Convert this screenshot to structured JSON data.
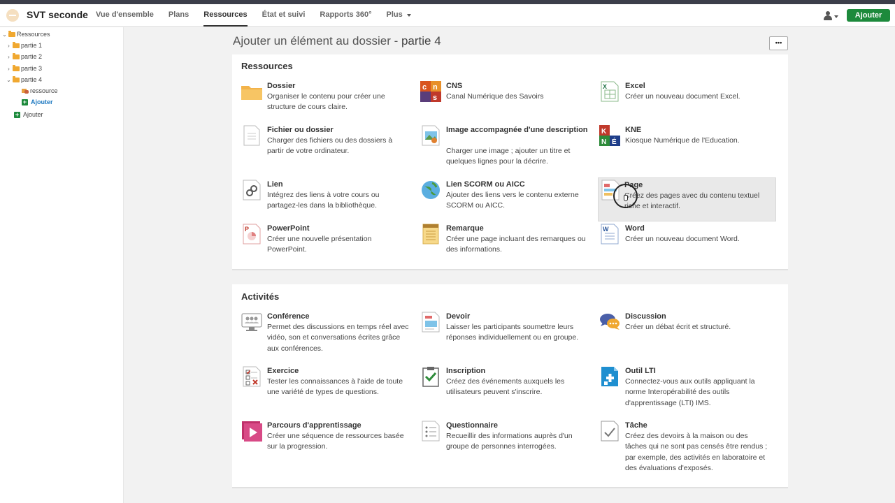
{
  "header": {
    "course_title": "SVT seconde",
    "nav": [
      "Vue d'ensemble",
      "Plans",
      "Ressources",
      "État et suivi",
      "Rapports 360°",
      "Plus"
    ],
    "add_label": "Ajouter"
  },
  "sidebar": {
    "root": "Ressources",
    "parts": [
      "partie 1",
      "partie 2",
      "partie 3",
      "partie 4"
    ],
    "resource": "ressource",
    "add_inner": "Ajouter",
    "add_outer": "Ajouter"
  },
  "page": {
    "title_prefix": "Ajouter un élément au dossier - ",
    "title_folder": "partie 4",
    "menu_label": "•••"
  },
  "resources": {
    "heading": "Ressources",
    "items": [
      {
        "name": "Dossier",
        "desc": "Organiser le contenu pour créer une structure de cours claire.",
        "icon": "folder-icon"
      },
      {
        "name": "CNS",
        "desc": "Canal Numérique des Savoirs",
        "icon": "cns-icon"
      },
      {
        "name": "Excel",
        "desc": "Créer un nouveau document Excel.",
        "icon": "excel-icon"
      },
      {
        "name": "Fichier ou dossier",
        "desc": "Charger des fichiers ou des dossiers à partir de votre ordinateur.",
        "icon": "file-icon"
      },
      {
        "name": "Image accompagnée d'une description",
        "desc": "Charger une image ; ajouter un titre et quelques lignes pour la décrire.",
        "icon": "image-icon"
      },
      {
        "name": "KNE",
        "desc": "Kiosque Numérique de l'Education.",
        "icon": "kne-icon"
      },
      {
        "name": "Lien",
        "desc": "Intégrez des liens à votre cours ou partagez-les dans la bibliothèque.",
        "icon": "link-icon"
      },
      {
        "name": "Lien SCORM ou AICC",
        "desc": "Ajouter des liens vers le contenu externe SCORM ou AICC.",
        "icon": "globe-icon"
      },
      {
        "name": "Page",
        "desc": "Créez des pages avec du contenu textuel riche et interactif.",
        "icon": "page-icon"
      },
      {
        "name": "PowerPoint",
        "desc": "Créer une nouvelle présentation PowerPoint.",
        "icon": "powerpoint-icon"
      },
      {
        "name": "Remarque",
        "desc": "Créer une page incluant des remarques ou des informations.",
        "icon": "note-icon"
      },
      {
        "name": "Word",
        "desc": "Créer un nouveau document Word.",
        "icon": "word-icon"
      }
    ]
  },
  "activities": {
    "heading": "Activités",
    "items": [
      {
        "name": "Conférence",
        "desc": "Permet des discussions en temps réel avec vidéo, son et conversations écrites grâce aux conférences.",
        "icon": "conference-icon"
      },
      {
        "name": "Devoir",
        "desc": "Laisser les participants soumettre leurs réponses individuellement ou en groupe.",
        "icon": "assignment-icon"
      },
      {
        "name": "Discussion",
        "desc": "Créer un débat écrit et structuré.",
        "icon": "discussion-icon"
      },
      {
        "name": "Exercice",
        "desc": "Tester les connaissances à l'aide de toute une variété de types de questions.",
        "icon": "quiz-icon"
      },
      {
        "name": "Inscription",
        "desc": "Créez des événements auxquels les utilisateurs peuvent s'inscrire.",
        "icon": "signup-icon"
      },
      {
        "name": "Outil LTI",
        "desc": "Connectez-vous aux outils appliquant la norme Interopérabilité des outils d'apprentissage (LTI) IMS.",
        "icon": "lti-icon"
      },
      {
        "name": "Parcours d'apprentissage",
        "desc": "Créer une séquence de ressources basée sur la progression.",
        "icon": "learning-path-icon"
      },
      {
        "name": "Questionnaire",
        "desc": "Recueillir des informations auprès d'un groupe de personnes interrogées.",
        "icon": "survey-icon"
      },
      {
        "name": "Tâche",
        "desc": "Créez des devoirs à la maison ou des tâches qui ne sont pas censés être rendus ; par exemple, des activités en laboratoire et des évaluations d'exposés.",
        "icon": "task-icon"
      }
    ]
  }
}
